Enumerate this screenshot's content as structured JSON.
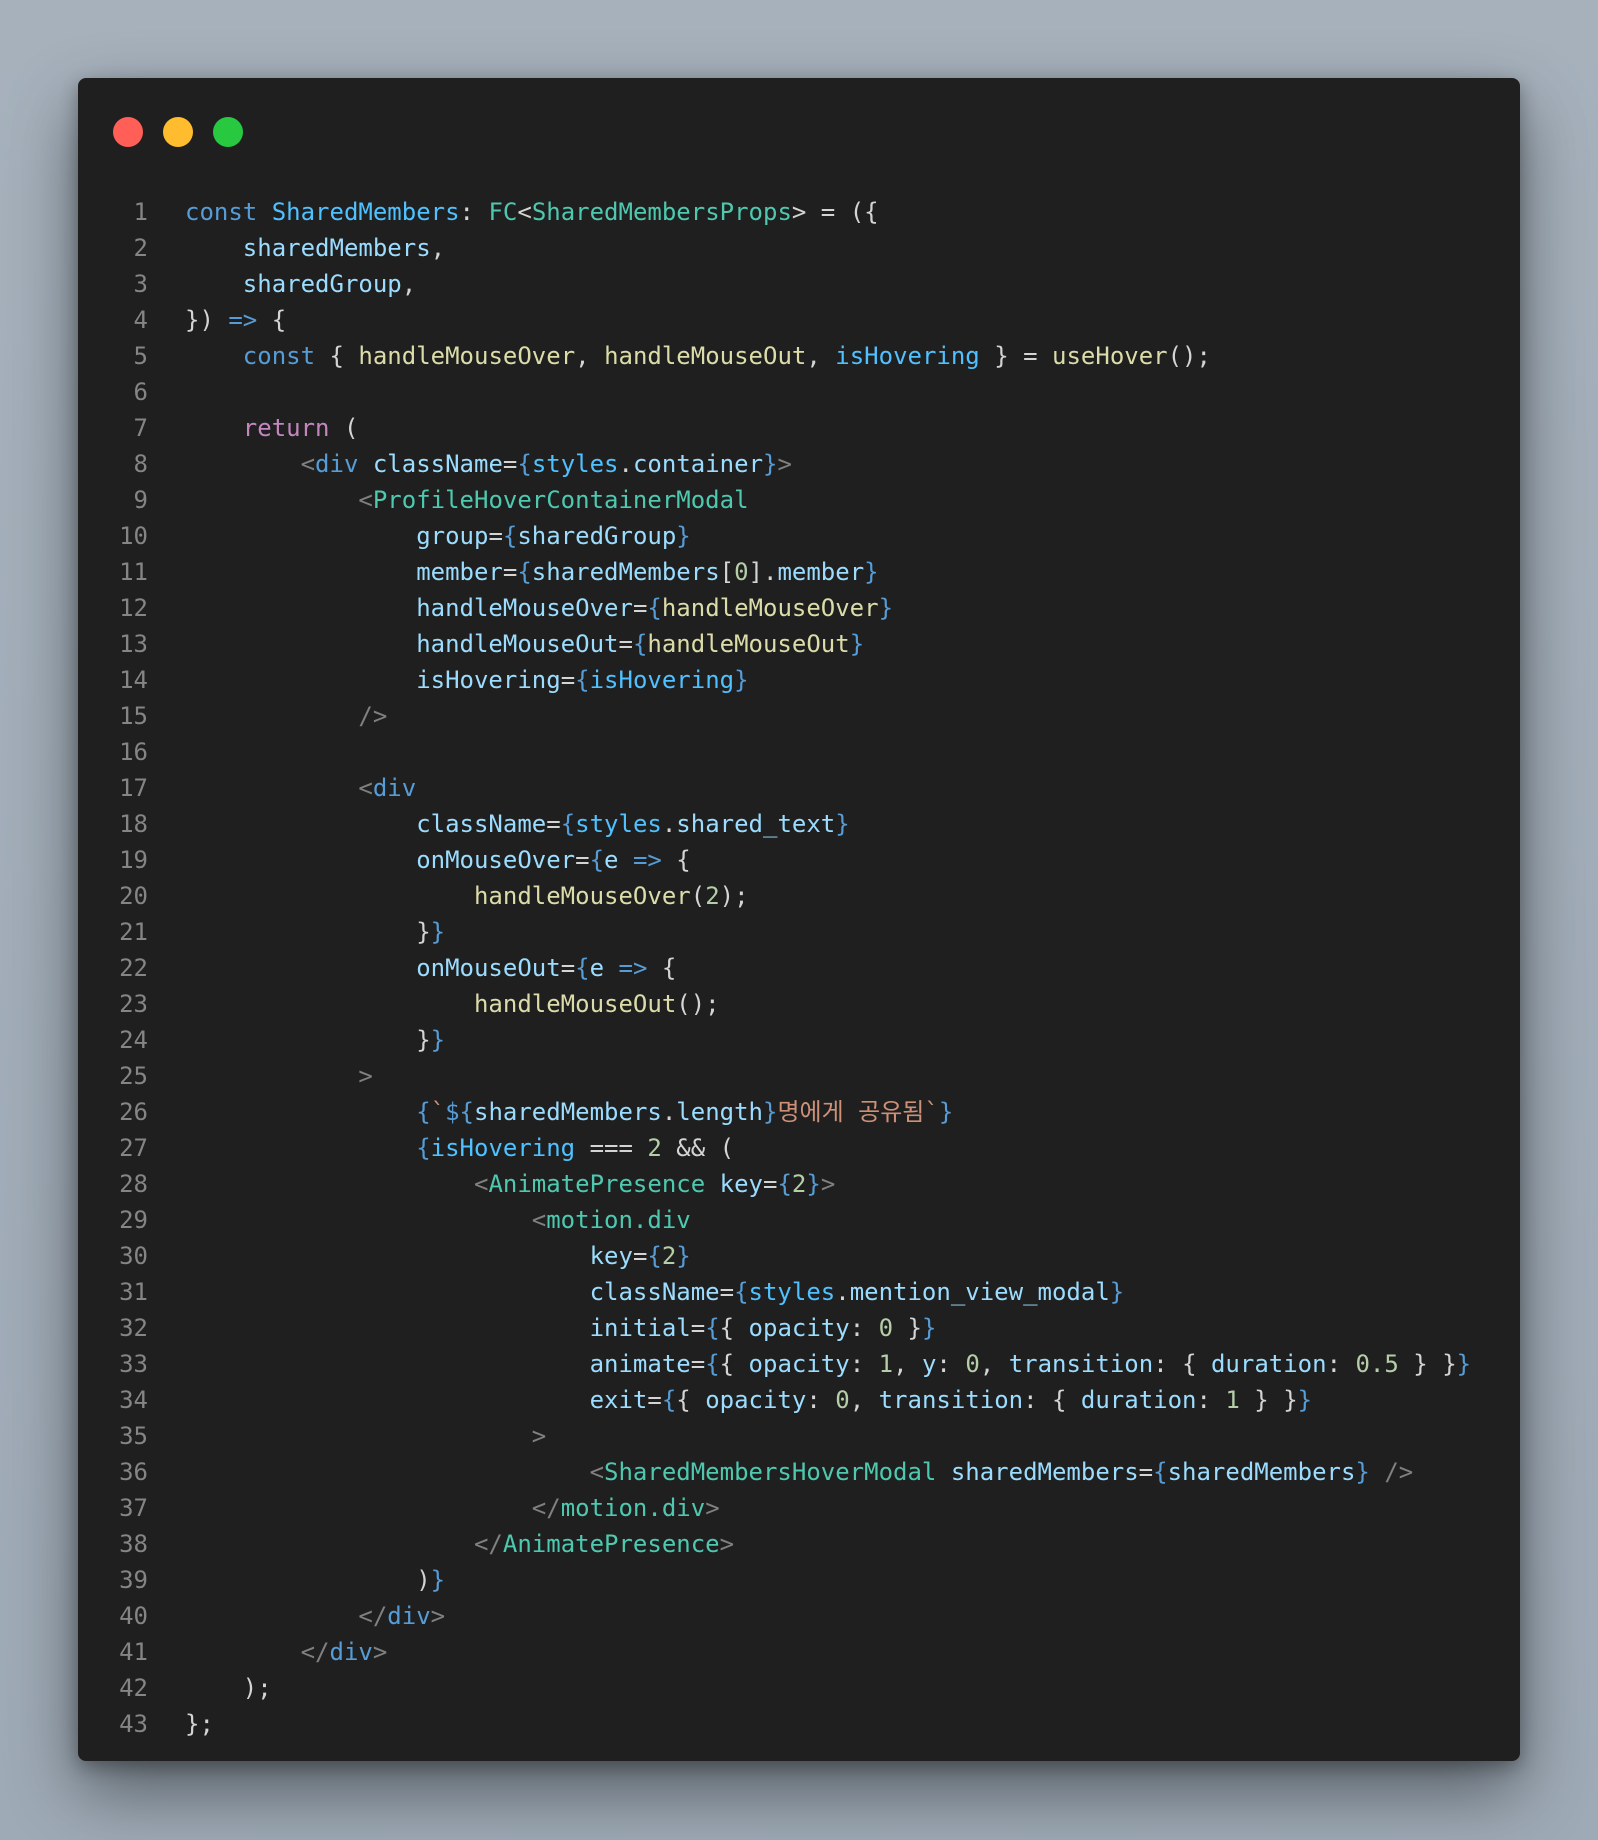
{
  "colors": {
    "close": "#ff5f57",
    "minimize": "#febc2e",
    "maximize": "#28c840",
    "plain": "#d4d4d4",
    "keyword": "#569cd6",
    "control": "#c586c0",
    "type": "#4ec9b0",
    "variable": "#9cdcfe",
    "constant": "#4fc1ff",
    "function": "#dcdcaa",
    "string": "#ce9178",
    "number": "#b5cea8",
    "tag_bracket": "#808080"
  },
  "icons": [
    "close-dot-icon",
    "minimize-dot-icon",
    "maximize-dot-icon"
  ],
  "code": {
    "lines": [
      {
        "n": "1",
        "tokens": [
          [
            "const ",
            "k"
          ],
          [
            "SharedMembers",
            "c"
          ],
          [
            ": ",
            "p"
          ],
          [
            "FC",
            "t"
          ],
          [
            "<",
            "p"
          ],
          [
            "SharedMembersProps",
            "t"
          ],
          [
            "> = ({",
            "p"
          ]
        ]
      },
      {
        "n": "2",
        "tokens": [
          [
            "    ",
            "p"
          ],
          [
            "sharedMembers",
            "v"
          ],
          [
            ",",
            "p"
          ]
        ]
      },
      {
        "n": "3",
        "tokens": [
          [
            "    ",
            "p"
          ],
          [
            "sharedGroup",
            "v"
          ],
          [
            ",",
            "p"
          ]
        ]
      },
      {
        "n": "4",
        "tokens": [
          [
            "}) ",
            "p"
          ],
          [
            "=>",
            "k"
          ],
          [
            " {",
            "p"
          ]
        ]
      },
      {
        "n": "5",
        "tokens": [
          [
            "    ",
            "p"
          ],
          [
            "const",
            "k"
          ],
          [
            " { ",
            "p"
          ],
          [
            "handleMouseOver",
            "f"
          ],
          [
            ", ",
            "p"
          ],
          [
            "handleMouseOut",
            "f"
          ],
          [
            ", ",
            "p"
          ],
          [
            "isHovering",
            "c"
          ],
          [
            " } = ",
            "p"
          ],
          [
            "useHover",
            "f"
          ],
          [
            "();",
            "p"
          ]
        ]
      },
      {
        "n": "6",
        "tokens": []
      },
      {
        "n": "7",
        "tokens": [
          [
            "    ",
            "p"
          ],
          [
            "return",
            "r"
          ],
          [
            " (",
            "p"
          ]
        ]
      },
      {
        "n": "8",
        "tokens": [
          [
            "        ",
            "p"
          ],
          [
            "<",
            "g"
          ],
          [
            "div",
            "k"
          ],
          [
            " ",
            "p"
          ],
          [
            "className",
            "v"
          ],
          [
            "=",
            "p"
          ],
          [
            "{",
            "k"
          ],
          [
            "styles",
            "c"
          ],
          [
            ".",
            "p"
          ],
          [
            "container",
            "v"
          ],
          [
            "}",
            "k"
          ],
          [
            ">",
            "g"
          ]
        ]
      },
      {
        "n": "9",
        "tokens": [
          [
            "            ",
            "p"
          ],
          [
            "<",
            "g"
          ],
          [
            "ProfileHoverContainerModal",
            "t"
          ]
        ]
      },
      {
        "n": "10",
        "tokens": [
          [
            "                ",
            "p"
          ],
          [
            "group",
            "v"
          ],
          [
            "=",
            "p"
          ],
          [
            "{",
            "k"
          ],
          [
            "sharedGroup",
            "v"
          ],
          [
            "}",
            "k"
          ]
        ]
      },
      {
        "n": "11",
        "tokens": [
          [
            "                ",
            "p"
          ],
          [
            "member",
            "v"
          ],
          [
            "=",
            "p"
          ],
          [
            "{",
            "k"
          ],
          [
            "sharedMembers",
            "v"
          ],
          [
            "[",
            "p"
          ],
          [
            "0",
            "n"
          ],
          [
            "].",
            "p"
          ],
          [
            "member",
            "v"
          ],
          [
            "}",
            "k"
          ]
        ]
      },
      {
        "n": "12",
        "tokens": [
          [
            "                ",
            "p"
          ],
          [
            "handleMouseOver",
            "v"
          ],
          [
            "=",
            "p"
          ],
          [
            "{",
            "k"
          ],
          [
            "handleMouseOver",
            "f"
          ],
          [
            "}",
            "k"
          ]
        ]
      },
      {
        "n": "13",
        "tokens": [
          [
            "                ",
            "p"
          ],
          [
            "handleMouseOut",
            "v"
          ],
          [
            "=",
            "p"
          ],
          [
            "{",
            "k"
          ],
          [
            "handleMouseOut",
            "f"
          ],
          [
            "}",
            "k"
          ]
        ]
      },
      {
        "n": "14",
        "tokens": [
          [
            "                ",
            "p"
          ],
          [
            "isHovering",
            "v"
          ],
          [
            "=",
            "p"
          ],
          [
            "{",
            "k"
          ],
          [
            "isHovering",
            "c"
          ],
          [
            "}",
            "k"
          ]
        ]
      },
      {
        "n": "15",
        "tokens": [
          [
            "            ",
            "p"
          ],
          [
            "/>",
            "g"
          ]
        ]
      },
      {
        "n": "16",
        "tokens": []
      },
      {
        "n": "17",
        "tokens": [
          [
            "            ",
            "p"
          ],
          [
            "<",
            "g"
          ],
          [
            "div",
            "k"
          ]
        ]
      },
      {
        "n": "18",
        "tokens": [
          [
            "                ",
            "p"
          ],
          [
            "className",
            "v"
          ],
          [
            "=",
            "p"
          ],
          [
            "{",
            "k"
          ],
          [
            "styles",
            "c"
          ],
          [
            ".",
            "p"
          ],
          [
            "shared_text",
            "v"
          ],
          [
            "}",
            "k"
          ]
        ]
      },
      {
        "n": "19",
        "tokens": [
          [
            "                ",
            "p"
          ],
          [
            "onMouseOver",
            "v"
          ],
          [
            "=",
            "p"
          ],
          [
            "{",
            "k"
          ],
          [
            "e",
            "v"
          ],
          [
            " ",
            "p"
          ],
          [
            "=>",
            "k"
          ],
          [
            " {",
            "p"
          ]
        ]
      },
      {
        "n": "20",
        "tokens": [
          [
            "                    ",
            "p"
          ],
          [
            "handleMouseOver",
            "f"
          ],
          [
            "(",
            "p"
          ],
          [
            "2",
            "n"
          ],
          [
            ");",
            "p"
          ]
        ]
      },
      {
        "n": "21",
        "tokens": [
          [
            "                ",
            "p"
          ],
          [
            "}",
            "p"
          ],
          [
            "}",
            "k"
          ]
        ]
      },
      {
        "n": "22",
        "tokens": [
          [
            "                ",
            "p"
          ],
          [
            "onMouseOut",
            "v"
          ],
          [
            "=",
            "p"
          ],
          [
            "{",
            "k"
          ],
          [
            "e",
            "v"
          ],
          [
            " ",
            "p"
          ],
          [
            "=>",
            "k"
          ],
          [
            " {",
            "p"
          ]
        ]
      },
      {
        "n": "23",
        "tokens": [
          [
            "                    ",
            "p"
          ],
          [
            "handleMouseOut",
            "f"
          ],
          [
            "();",
            "p"
          ]
        ]
      },
      {
        "n": "24",
        "tokens": [
          [
            "                ",
            "p"
          ],
          [
            "}",
            "p"
          ],
          [
            "}",
            "k"
          ]
        ]
      },
      {
        "n": "25",
        "tokens": [
          [
            "            ",
            "p"
          ],
          [
            ">",
            "g"
          ]
        ]
      },
      {
        "n": "26",
        "tokens": [
          [
            "                ",
            "p"
          ],
          [
            "{",
            "k"
          ],
          [
            "`",
            "s"
          ],
          [
            "${",
            "k"
          ],
          [
            "sharedMembers",
            "v"
          ],
          [
            ".",
            "p"
          ],
          [
            "length",
            "v"
          ],
          [
            "}",
            "k"
          ],
          [
            "명에게 공유됨`",
            "s"
          ],
          [
            "}",
            "k"
          ]
        ]
      },
      {
        "n": "27",
        "tokens": [
          [
            "                ",
            "p"
          ],
          [
            "{",
            "k"
          ],
          [
            "isHovering",
            "c"
          ],
          [
            " === ",
            "p"
          ],
          [
            "2",
            "n"
          ],
          [
            " && (",
            "p"
          ]
        ]
      },
      {
        "n": "28",
        "tokens": [
          [
            "                    ",
            "p"
          ],
          [
            "<",
            "g"
          ],
          [
            "AnimatePresence",
            "t"
          ],
          [
            " ",
            "p"
          ],
          [
            "key",
            "v"
          ],
          [
            "=",
            "p"
          ],
          [
            "{",
            "k"
          ],
          [
            "2",
            "n"
          ],
          [
            "}",
            "k"
          ],
          [
            ">",
            "g"
          ]
        ]
      },
      {
        "n": "29",
        "tokens": [
          [
            "                        ",
            "p"
          ],
          [
            "<",
            "g"
          ],
          [
            "motion.div",
            "t"
          ]
        ]
      },
      {
        "n": "30",
        "tokens": [
          [
            "                            ",
            "p"
          ],
          [
            "key",
            "v"
          ],
          [
            "=",
            "p"
          ],
          [
            "{",
            "k"
          ],
          [
            "2",
            "n"
          ],
          [
            "}",
            "k"
          ]
        ]
      },
      {
        "n": "31",
        "tokens": [
          [
            "                            ",
            "p"
          ],
          [
            "className",
            "v"
          ],
          [
            "=",
            "p"
          ],
          [
            "{",
            "k"
          ],
          [
            "styles",
            "c"
          ],
          [
            ".",
            "p"
          ],
          [
            "mention_view_modal",
            "v"
          ],
          [
            "}",
            "k"
          ]
        ]
      },
      {
        "n": "32",
        "tokens": [
          [
            "                            ",
            "p"
          ],
          [
            "initial",
            "v"
          ],
          [
            "=",
            "p"
          ],
          [
            "{",
            "k"
          ],
          [
            "{ ",
            "p"
          ],
          [
            "opacity",
            "v"
          ],
          [
            ": ",
            "p"
          ],
          [
            "0",
            "n"
          ],
          [
            " }",
            "p"
          ],
          [
            "}",
            "k"
          ]
        ]
      },
      {
        "n": "33",
        "tokens": [
          [
            "                            ",
            "p"
          ],
          [
            "animate",
            "v"
          ],
          [
            "=",
            "p"
          ],
          [
            "{",
            "k"
          ],
          [
            "{ ",
            "p"
          ],
          [
            "opacity",
            "v"
          ],
          [
            ": ",
            "p"
          ],
          [
            "1",
            "n"
          ],
          [
            ", ",
            "p"
          ],
          [
            "y",
            "v"
          ],
          [
            ": ",
            "p"
          ],
          [
            "0",
            "n"
          ],
          [
            ", ",
            "p"
          ],
          [
            "transition",
            "v"
          ],
          [
            ": { ",
            "p"
          ],
          [
            "duration",
            "v"
          ],
          [
            ": ",
            "p"
          ],
          [
            "0.5",
            "n"
          ],
          [
            " } }",
            "p"
          ],
          [
            "}",
            "k"
          ]
        ]
      },
      {
        "n": "34",
        "tokens": [
          [
            "                            ",
            "p"
          ],
          [
            "exit",
            "v"
          ],
          [
            "=",
            "p"
          ],
          [
            "{",
            "k"
          ],
          [
            "{ ",
            "p"
          ],
          [
            "opacity",
            "v"
          ],
          [
            ": ",
            "p"
          ],
          [
            "0",
            "n"
          ],
          [
            ", ",
            "p"
          ],
          [
            "transition",
            "v"
          ],
          [
            ": { ",
            "p"
          ],
          [
            "duration",
            "v"
          ],
          [
            ": ",
            "p"
          ],
          [
            "1",
            "n"
          ],
          [
            " } }",
            "p"
          ],
          [
            "}",
            "k"
          ]
        ]
      },
      {
        "n": "35",
        "tokens": [
          [
            "                        ",
            "p"
          ],
          [
            ">",
            "g"
          ]
        ]
      },
      {
        "n": "36",
        "tokens": [
          [
            "                            ",
            "p"
          ],
          [
            "<",
            "g"
          ],
          [
            "SharedMembersHoverModal",
            "t"
          ],
          [
            " ",
            "p"
          ],
          [
            "sharedMembers",
            "v"
          ],
          [
            "=",
            "p"
          ],
          [
            "{",
            "k"
          ],
          [
            "sharedMembers",
            "v"
          ],
          [
            "}",
            "k"
          ],
          [
            " ",
            "p"
          ],
          [
            "/>",
            "g"
          ]
        ]
      },
      {
        "n": "37",
        "tokens": [
          [
            "                        ",
            "p"
          ],
          [
            "</",
            "g"
          ],
          [
            "motion.div",
            "t"
          ],
          [
            ">",
            "g"
          ]
        ]
      },
      {
        "n": "38",
        "tokens": [
          [
            "                    ",
            "p"
          ],
          [
            "</",
            "g"
          ],
          [
            "AnimatePresence",
            "t"
          ],
          [
            ">",
            "g"
          ]
        ]
      },
      {
        "n": "39",
        "tokens": [
          [
            "                ",
            "p"
          ],
          [
            ")",
            "p"
          ],
          [
            "}",
            "k"
          ]
        ]
      },
      {
        "n": "40",
        "tokens": [
          [
            "            ",
            "p"
          ],
          [
            "</",
            "g"
          ],
          [
            "div",
            "k"
          ],
          [
            ">",
            "g"
          ]
        ]
      },
      {
        "n": "41",
        "tokens": [
          [
            "        ",
            "p"
          ],
          [
            "</",
            "g"
          ],
          [
            "div",
            "k"
          ],
          [
            ">",
            "g"
          ]
        ]
      },
      {
        "n": "42",
        "tokens": [
          [
            "    ",
            "p"
          ],
          [
            ");",
            "p"
          ]
        ]
      },
      {
        "n": "43",
        "tokens": [
          [
            "};",
            "p"
          ]
        ]
      }
    ]
  }
}
